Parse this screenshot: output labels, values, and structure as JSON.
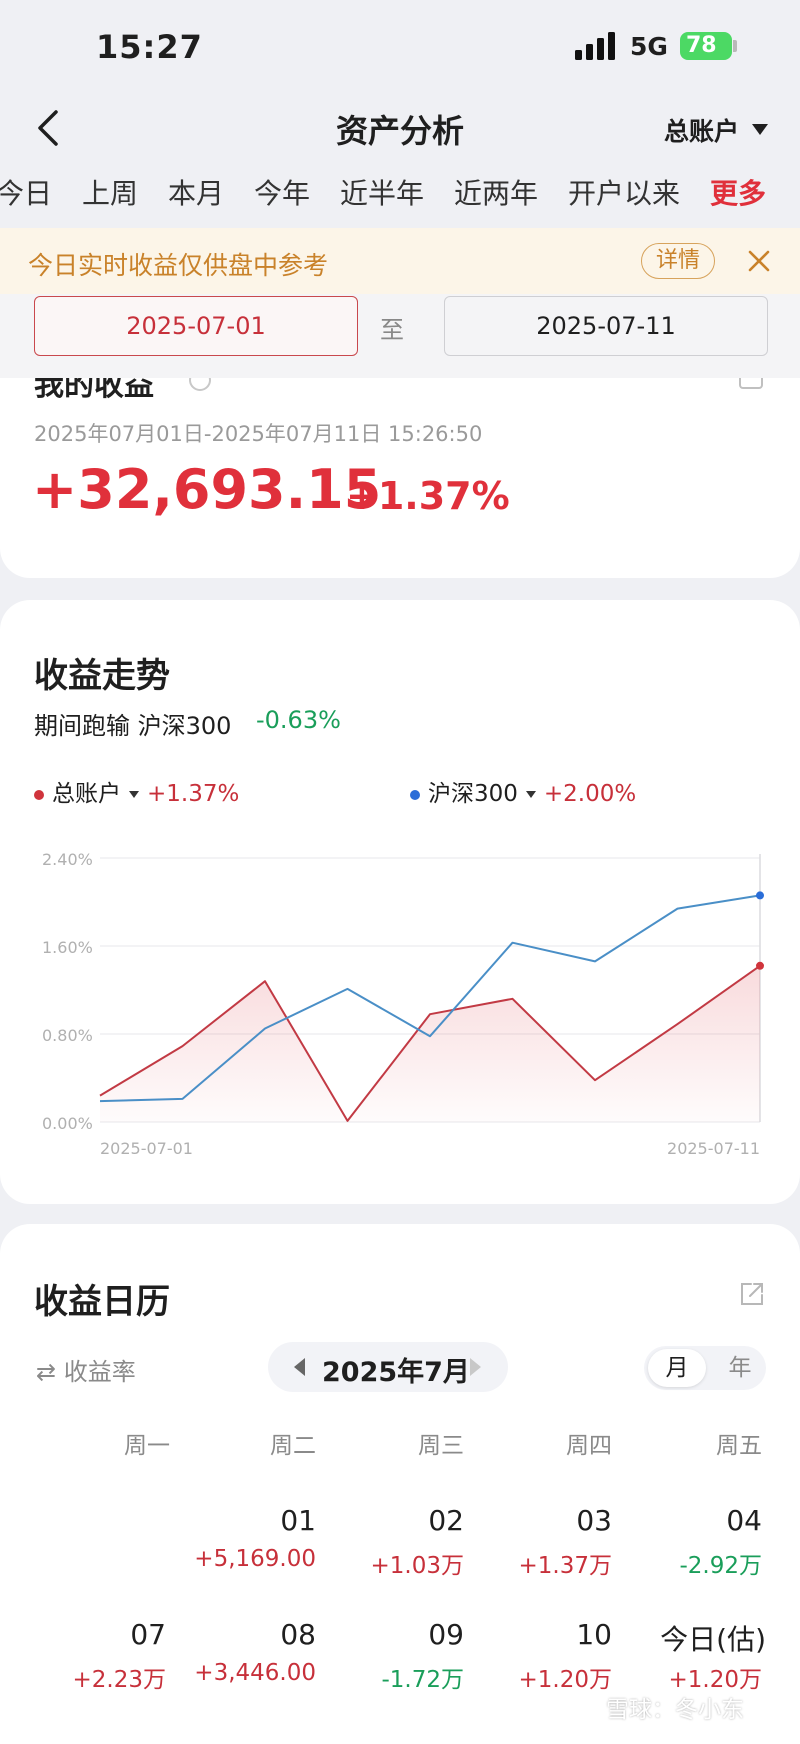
{
  "status_bar": {
    "time": "15:27",
    "network": "5G",
    "battery": "78"
  },
  "nav": {
    "title": "资产分析",
    "account": "总账户"
  },
  "tabs": [
    {
      "label": "今日"
    },
    {
      "label": "上周"
    },
    {
      "label": "本月"
    },
    {
      "label": "今年"
    },
    {
      "label": "近半年"
    },
    {
      "label": "近两年"
    },
    {
      "label": "开户以来"
    },
    {
      "label": "更多"
    }
  ],
  "notice": {
    "text": "今日实时收益仅供盘中参考",
    "detail": "详情"
  },
  "date_range": {
    "start": "2025-07-01",
    "separator": "至",
    "end": "2025-07-11"
  },
  "summary": {
    "title": "我的收益",
    "range": "2025年07月01日-2025年07月11日 15:26:50",
    "profit": "+32,693.15",
    "rate": "+1.37%"
  },
  "trend": {
    "title": "收益走势",
    "lag_label": "期间跑输 沪深300",
    "lag_value": "-0.63%",
    "legend": [
      {
        "name": "总账户",
        "value": "+1.37%",
        "color": "#d0343c"
      },
      {
        "name": "沪深300",
        "value": "+2.00%",
        "color": "#2a6dd8"
      }
    ]
  },
  "chart_data": {
    "type": "line",
    "x": [
      "2025-07-01",
      "2025-07-02",
      "2025-07-03",
      "2025-07-04",
      "2025-07-07",
      "2025-07-08",
      "2025-07-09",
      "2025-07-10",
      "2025-07-11"
    ],
    "x_tick_labels": [
      "2025-07-01",
      "2025-07-11"
    ],
    "y_tick_labels": [
      "2.40%",
      "1.60%",
      "0.80%",
      "0.00%"
    ],
    "ylim": [
      0,
      2.4
    ],
    "series": [
      {
        "name": "总账户",
        "color": "#c23a44",
        "values": [
          0.24,
          0.69,
          1.28,
          0.01,
          0.98,
          1.12,
          0.38,
          0.89,
          1.42
        ],
        "fill": true
      },
      {
        "name": "沪深300",
        "color": "#4a8fc7",
        "values": [
          0.19,
          0.21,
          0.85,
          1.21,
          0.78,
          1.63,
          1.46,
          1.94,
          2.06
        ]
      }
    ]
  },
  "calendar": {
    "title": "收益日历",
    "rate_toggle": "⇄ 收益率",
    "month": "2025年7月",
    "view_month": "月",
    "view_year": "年",
    "weekdays": [
      "周一",
      "周二",
      "周三",
      "周四",
      "周五"
    ],
    "row1": [
      {
        "day": "01",
        "value": "+5,169.00"
      },
      {
        "day": "02",
        "value": "+1.03万"
      },
      {
        "day": "03",
        "value": "+1.37万"
      },
      {
        "day": "04",
        "value": "-2.92万"
      }
    ],
    "row2": [
      {
        "day": "07",
        "value": "+2.23万"
      },
      {
        "day": "08",
        "value": "+3,446.00"
      },
      {
        "day": "09",
        "value": "-1.72万"
      },
      {
        "day": "10",
        "value": "+1.20万"
      },
      {
        "day": "今日(估)",
        "value": "+1.20万"
      }
    ]
  },
  "watermark": "雪球：冬小东"
}
